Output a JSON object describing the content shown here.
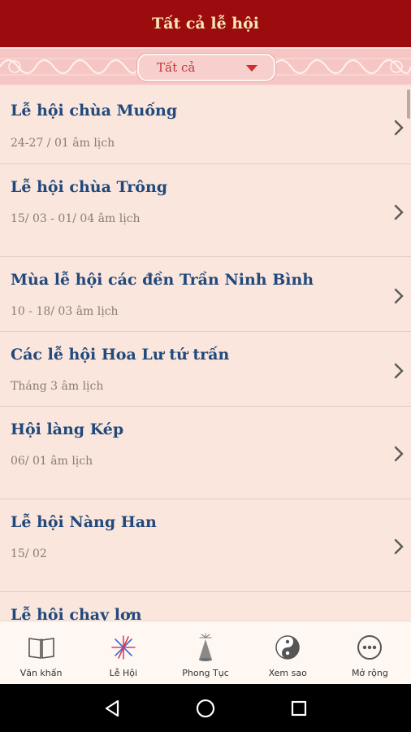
{
  "header": {
    "title": "Tất cả lễ hội"
  },
  "filter": {
    "selected": "Tất cả"
  },
  "festivals": [
    {
      "title": "Lễ hội chùa Muống",
      "date": "24-27 / 01 âm lịch"
    },
    {
      "title": "Lễ hội chùa Trông",
      "date": "15/ 03 - 01/ 04 âm lịch"
    },
    {
      "title": "Mùa lễ hội các đền Trần Ninh Bình",
      "date": "10 - 18/ 03 âm lịch"
    },
    {
      "title": "Các lễ hội Hoa Lư tứ trấn",
      "date": "Tháng 3 âm lịch"
    },
    {
      "title": "Hội làng Kép",
      "date": "06/ 01 âm lịch"
    },
    {
      "title": "Lễ hội Nàng Han",
      "date": "15/ 02"
    },
    {
      "title": "Lễ hội chay lợn",
      "date": ""
    }
  ],
  "tabs": [
    {
      "label": "Văn khấn",
      "icon": "book-icon"
    },
    {
      "label": "Lễ Hội",
      "icon": "fireworks-icon"
    },
    {
      "label": "Phong Tục",
      "icon": "firecracker-icon"
    },
    {
      "label": "Xem sao",
      "icon": "yin-yang-icon"
    },
    {
      "label": "Mở rộng",
      "icon": "more-icon"
    }
  ],
  "colors": {
    "header": "#9c0c0e",
    "title_text": "#21497c",
    "background": "#fae6dc"
  }
}
